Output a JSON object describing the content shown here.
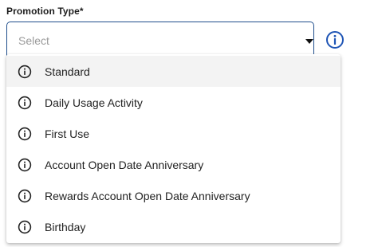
{
  "field": {
    "label": "Promotion Type*",
    "placeholder": "Select",
    "caret_icon": "caret-down-icon",
    "help_icon": "info-circle-icon"
  },
  "menu": {
    "items": [
      {
        "label": "Standard",
        "icon": "info-icon",
        "highlighted": true
      },
      {
        "label": "Daily Usage Activity",
        "icon": "info-icon",
        "highlighted": false
      },
      {
        "label": "First Use",
        "icon": "info-icon",
        "highlighted": false
      },
      {
        "label": "Account Open Date Anniversary",
        "icon": "info-icon",
        "highlighted": false
      },
      {
        "label": "Rewards Account Open Date Anniversary",
        "icon": "info-icon",
        "highlighted": false
      },
      {
        "label": "Birthday",
        "icon": "info-icon",
        "highlighted": false
      }
    ]
  },
  "colors": {
    "accent": "#1f4e8c",
    "help_icon": "#1f55b5",
    "placeholder": "#9a9a9a",
    "highlight_bg": "#f3f3f3",
    "text": "#222222"
  }
}
